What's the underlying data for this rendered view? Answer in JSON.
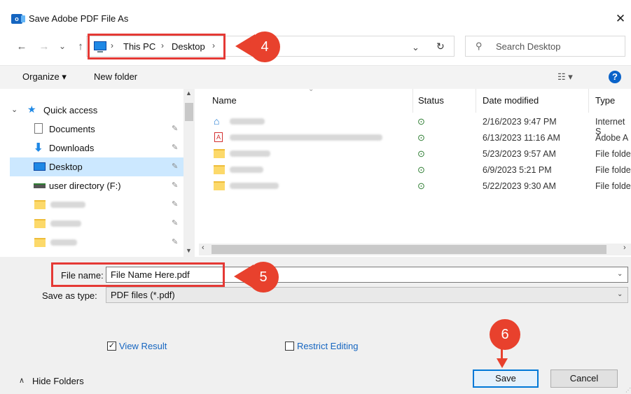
{
  "window": {
    "title": "Save Adobe PDF File As",
    "close_glyph": "✕",
    "app_icon_letter": "o"
  },
  "nav": {
    "back": "←",
    "forward": "→",
    "recent": "⌄",
    "up": "↑",
    "breadcrumb": [
      "This PC",
      "Desktop"
    ],
    "crumb_sep": "›",
    "dropdown_glyph": "⌄",
    "refresh_glyph": "↻",
    "search_placeholder": "Search Desktop"
  },
  "badges": {
    "step4": "4",
    "step5": "5",
    "step6": "6"
  },
  "toolbar": {
    "organize": "Organize ▾",
    "new_folder": "New folder",
    "view_glyph": "☷ ▾",
    "help": "?"
  },
  "sidebar": {
    "quick_access": "Quick access",
    "items": [
      {
        "label": "Documents",
        "icon": "documents-icon",
        "pinned": true
      },
      {
        "label": "Downloads",
        "icon": "downloads-icon",
        "pinned": true
      },
      {
        "label": "Desktop",
        "icon": "desktop-icon",
        "pinned": true,
        "selected": true
      },
      {
        "label": "user directory (F:)",
        "icon": "drive-icon",
        "pinned": true
      }
    ],
    "pin_glyph": "📌"
  },
  "file_list": {
    "columns": [
      "Name",
      "Status",
      "Date modified",
      "Type"
    ],
    "rows": [
      {
        "date": "2/16/2023 9:47 PM",
        "type": "Internet S",
        "icon": "shortcut-icon"
      },
      {
        "date": "6/13/2023 11:16 AM",
        "type": "Adobe A",
        "icon": "pdf-icon"
      },
      {
        "date": "5/23/2023 9:57 AM",
        "type": "File folde",
        "icon": "folder-icon"
      },
      {
        "date": "6/9/2023 5:21 PM",
        "type": "File folde",
        "icon": "folder-icon"
      },
      {
        "date": "5/22/2023 9:30 AM",
        "type": "File folde",
        "icon": "folder-icon"
      }
    ],
    "status_glyph": "⊙"
  },
  "form": {
    "file_name_label": "File name:",
    "file_name_value": "File Name Here.pdf",
    "save_type_label": "Save as type:",
    "save_type_value": "PDF files (*.pdf)"
  },
  "options": {
    "view_result": "View Result",
    "view_result_checked": true,
    "restrict_editing": "Restrict Editing",
    "restrict_editing_checked": false
  },
  "footer": {
    "hide_folders": "Hide Folders",
    "save": "Save",
    "cancel": "Cancel"
  },
  "colors": {
    "accent": "#0078d7",
    "highlight": "#e53935",
    "badge": "#e8412d"
  }
}
